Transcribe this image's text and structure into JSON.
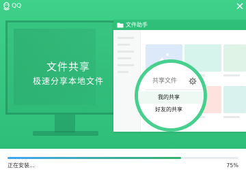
{
  "app": {
    "title": "QQ",
    "close_icon": "close-icon",
    "logo_icon": "qq-penguin-icon"
  },
  "banner": {
    "headline": "文件共享",
    "subline": "极速分享本地文件",
    "background_color": "#3fd08a"
  },
  "file_helper": {
    "window_title": "文件助手",
    "icon": "folder-icon",
    "share_menu": {
      "title": "共享文件",
      "settings_icon": "gear-icon",
      "items": [
        {
          "label": "我的共享",
          "selected": true
        },
        {
          "label": "好友的共享",
          "selected": false
        }
      ]
    },
    "card_colors": [
      "#dce9f8",
      "#d6f3ec",
      "#dff4e6",
      "#fbdede",
      "#fde2dd",
      "#d9f2ee"
    ]
  },
  "install": {
    "status": "正在安装...",
    "progress_percent": 75,
    "progress_label": "75%",
    "progress_colors": [
      "#3fa5f5",
      "#35b26a"
    ]
  }
}
